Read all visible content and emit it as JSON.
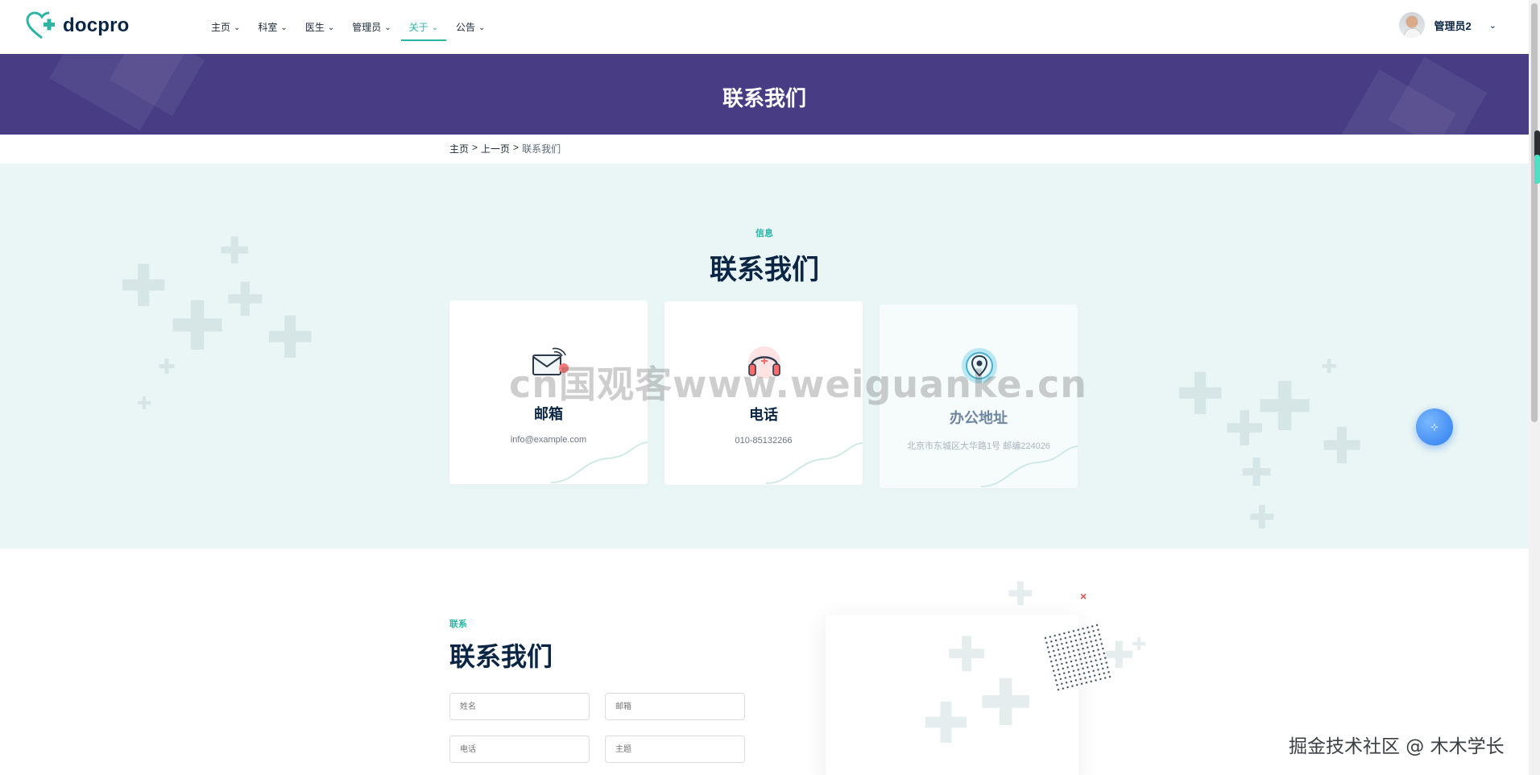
{
  "brand": {
    "name": "docpro",
    "accent": "#2cb5a5",
    "banner_color": "#483d85"
  },
  "nav": {
    "items": [
      {
        "label": "主页",
        "active": false
      },
      {
        "label": "科室",
        "active": false
      },
      {
        "label": "医生",
        "active": false
      },
      {
        "label": "管理员",
        "active": false
      },
      {
        "label": "关于",
        "active": true
      },
      {
        "label": "公告",
        "active": false
      }
    ]
  },
  "user": {
    "name": "管理员2"
  },
  "banner": {
    "title": "联系我们"
  },
  "breadcrumb": {
    "home": "主页",
    "sep": ">",
    "prev": "上一页",
    "current": "联系我们"
  },
  "info": {
    "eyebrow": "信息",
    "title": "联系我们",
    "cards": [
      {
        "icon": "mail-icon",
        "title": "邮箱",
        "value": "info@example.com"
      },
      {
        "icon": "phone-headset-icon",
        "title": "电话",
        "value": "010-85132266"
      },
      {
        "icon": "location-pin-icon",
        "title": "办公地址",
        "value": "北京市东城区大华路1号 邮编224026"
      }
    ]
  },
  "watermark": "cn国观客www.weiguanke.cn",
  "contact_form": {
    "eyebrow": "联系",
    "title": "联系我们",
    "fields": {
      "name_placeholder": "姓名",
      "email_placeholder": "邮箱",
      "phone_placeholder": "电话",
      "subject_placeholder": "主题"
    }
  },
  "close_glyph": "×",
  "footer_credit": "掘金技术社区 @ 木木学长"
}
